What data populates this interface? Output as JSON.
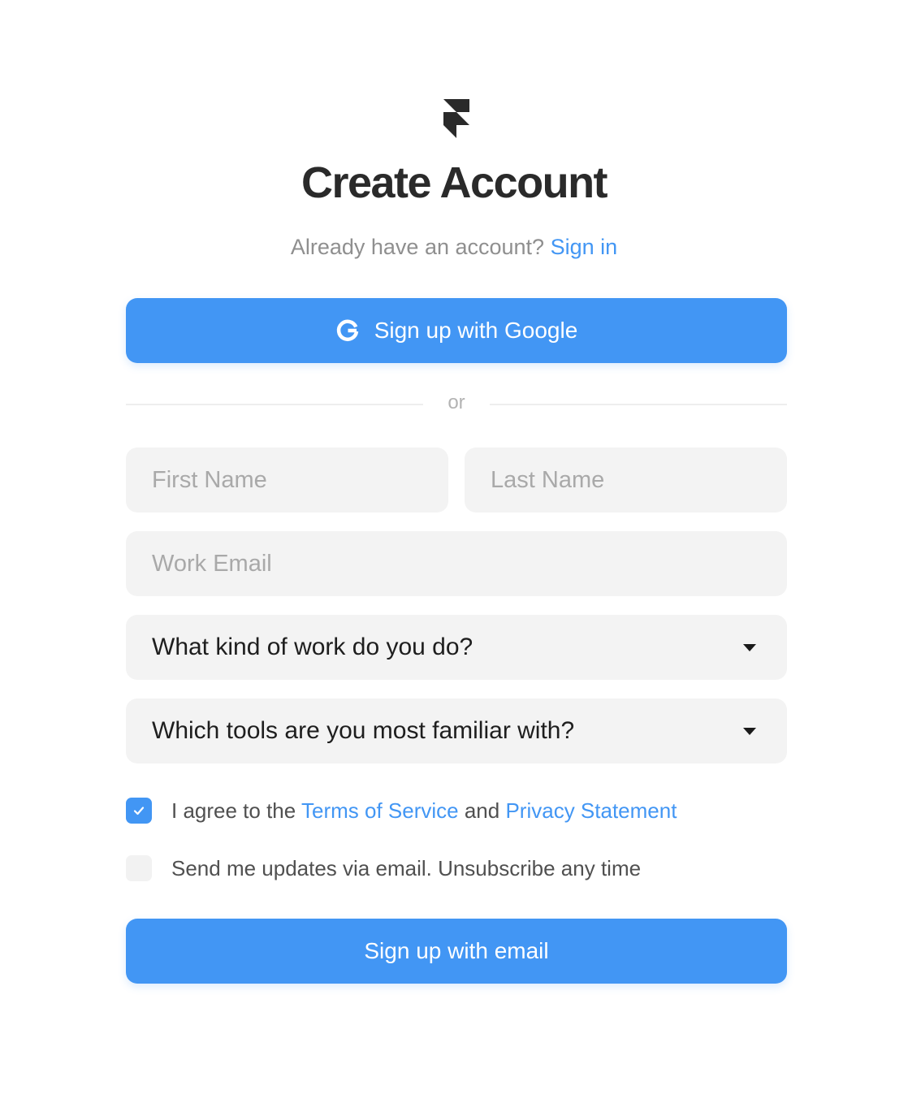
{
  "brand": {
    "logo_icon": "framer-logo-icon",
    "accent_color": "#4296f4"
  },
  "header": {
    "title": "Create Account",
    "subtitle_text": "Already have an account?",
    "signin_link": "Sign in"
  },
  "google_button": {
    "label": "Sign up with Google",
    "icon": "google-g-icon"
  },
  "divider": {
    "text": "or"
  },
  "form": {
    "first_name_placeholder": "First Name",
    "last_name_placeholder": "Last Name",
    "work_email_placeholder": "Work Email",
    "work_kind_select": "What kind of work do you do?",
    "tools_select": "Which tools are you most familiar with?"
  },
  "consent": {
    "terms_checked": true,
    "terms_prefix": "I agree to the",
    "terms_link": "Terms of Service",
    "terms_and": "and",
    "privacy_link": "Privacy Statement",
    "updates_checked": false,
    "updates_label": "Send me updates via email. Unsubscribe any time"
  },
  "email_button": {
    "label": "Sign up with email"
  }
}
